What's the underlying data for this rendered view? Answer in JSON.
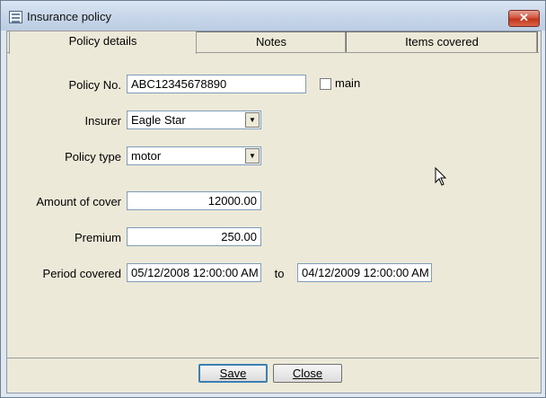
{
  "window": {
    "title": "Insurance policy",
    "close_symbol": "✕"
  },
  "tabs": [
    {
      "label": "Policy details",
      "active": true
    },
    {
      "label": "Notes",
      "active": false
    },
    {
      "label": "Items covered",
      "active": false
    }
  ],
  "form": {
    "policy_no": {
      "label": "Policy No.",
      "value": "ABC12345678890"
    },
    "main": {
      "label": "main",
      "checked": false
    },
    "insurer": {
      "label": "Insurer",
      "value": "Eagle Star"
    },
    "policy_type": {
      "label": "Policy type",
      "value": "motor"
    },
    "amount_of_cover": {
      "label": "Amount of cover",
      "value": "12000.00"
    },
    "premium": {
      "label": "Premium",
      "value": "250.00"
    },
    "period": {
      "label": "Period covered",
      "from": "05/12/2008 12:00:00 AM",
      "to_label": "to",
      "to": "04/12/2009 12:00:00 AM"
    }
  },
  "buttons": {
    "save": "Save",
    "close": "Close"
  },
  "icons": {
    "window_icon": "list-window-icon",
    "dropdown": "dropdown-arrow-icon",
    "cursor": "mouse-pointer-icon"
  }
}
